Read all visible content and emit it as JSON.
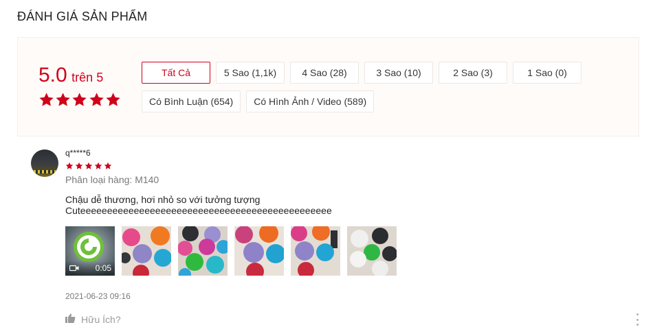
{
  "page": {
    "title": "ĐÁNH GIÁ SẢN PHẨM"
  },
  "overview": {
    "rating_value": "5.0",
    "rating_suffix": "trên 5",
    "stars": 5,
    "star_color": "#d0011b",
    "filters_row1": [
      "Tất Cả",
      "5 Sao (1,1k)",
      "4 Sao (28)",
      "3 Sao (10)",
      "2 Sao (3)",
      "1 Sao (0)"
    ],
    "filters_row2": [
      "Có Bình Luận (654)",
      "Có Hình Ảnh / Video (589)"
    ],
    "active_filter": "Tất Cả"
  },
  "review": {
    "author": "q*****6",
    "stars": 5,
    "variation": "Phân loại hàng: M140",
    "content_lines": [
      "Chậu dễ thương, hơi nhỏ so với tưởng tượng",
      "Cuteeeeeeeeeeeeeeeeeeeeeeeeeeeeeeeeeeeeeeeeeeeeeee"
    ],
    "video_duration": "0:05",
    "media_count": 6,
    "timestamp": "2021-06-23 09:16",
    "helpful_label": "Hữu Ích?"
  },
  "icons": {
    "star": "star-icon",
    "video": "video-camera-icon",
    "like": "thumbs-up-icon",
    "more": "more-vertical-icon"
  }
}
